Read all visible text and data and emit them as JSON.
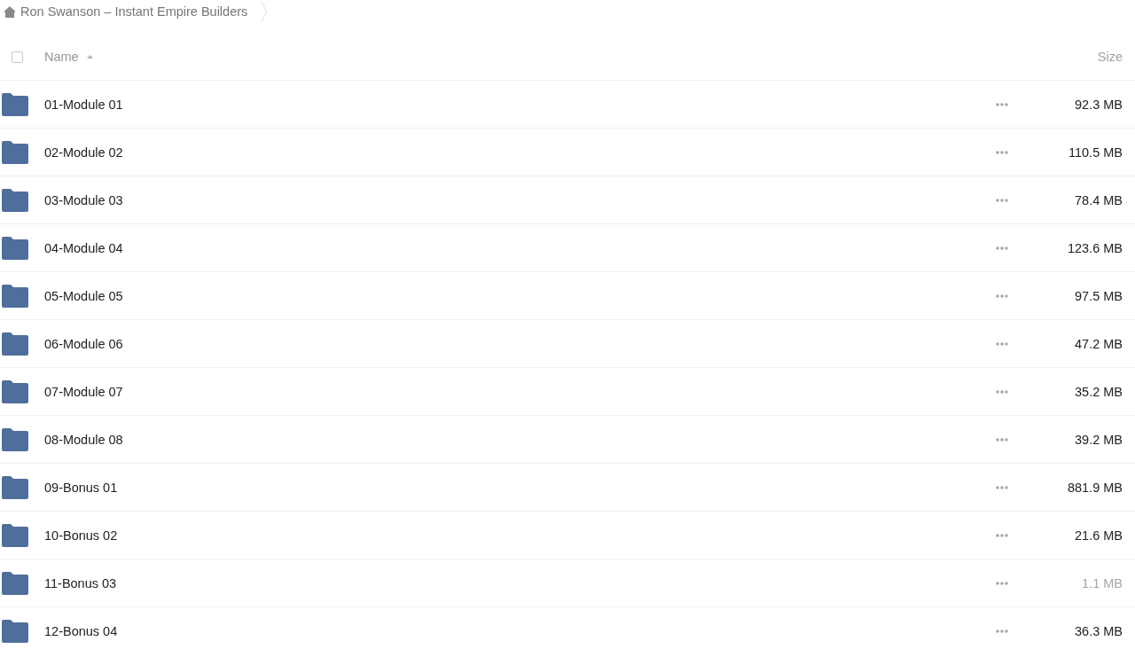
{
  "breadcrumb": {
    "items": [
      {
        "label": "Ron Swanson – Instant Empire Builders"
      }
    ]
  },
  "table": {
    "select_all": {
      "checked": false
    },
    "columns": [
      {
        "label": "Name",
        "sorted": true
      },
      {
        "label": "Size",
        "sorted": false
      }
    ],
    "rows": [
      {
        "kind": "folder",
        "name": "01-Module 01",
        "size": "92.3 MB",
        "faded": false
      },
      {
        "kind": "folder",
        "name": "02-Module 02",
        "size": "110.5 MB",
        "faded": false
      },
      {
        "kind": "folder",
        "name": "03-Module 03",
        "size": "78.4 MB",
        "faded": false
      },
      {
        "kind": "folder",
        "name": "04-Module 04",
        "size": "123.6 MB",
        "faded": false
      },
      {
        "kind": "folder",
        "name": "05-Module 05",
        "size": "97.5 MB",
        "faded": false
      },
      {
        "kind": "folder",
        "name": "06-Module 06",
        "size": "47.2 MB",
        "faded": false
      },
      {
        "kind": "folder",
        "name": "07-Module 07",
        "size": "35.2 MB",
        "faded": false
      },
      {
        "kind": "folder",
        "name": "08-Module 08",
        "size": "39.2 MB",
        "faded": false
      },
      {
        "kind": "folder",
        "name": "09-Bonus 01",
        "size": "881.9 MB",
        "faded": false
      },
      {
        "kind": "folder",
        "name": "10-Bonus 02",
        "size": "21.6 MB",
        "faded": false
      },
      {
        "kind": "folder",
        "name": "11-Bonus 03",
        "size": "1.1 MB",
        "faded": true
      },
      {
        "kind": "folder",
        "name": "12-Bonus 04",
        "size": "36.3 MB",
        "faded": false
      }
    ]
  }
}
